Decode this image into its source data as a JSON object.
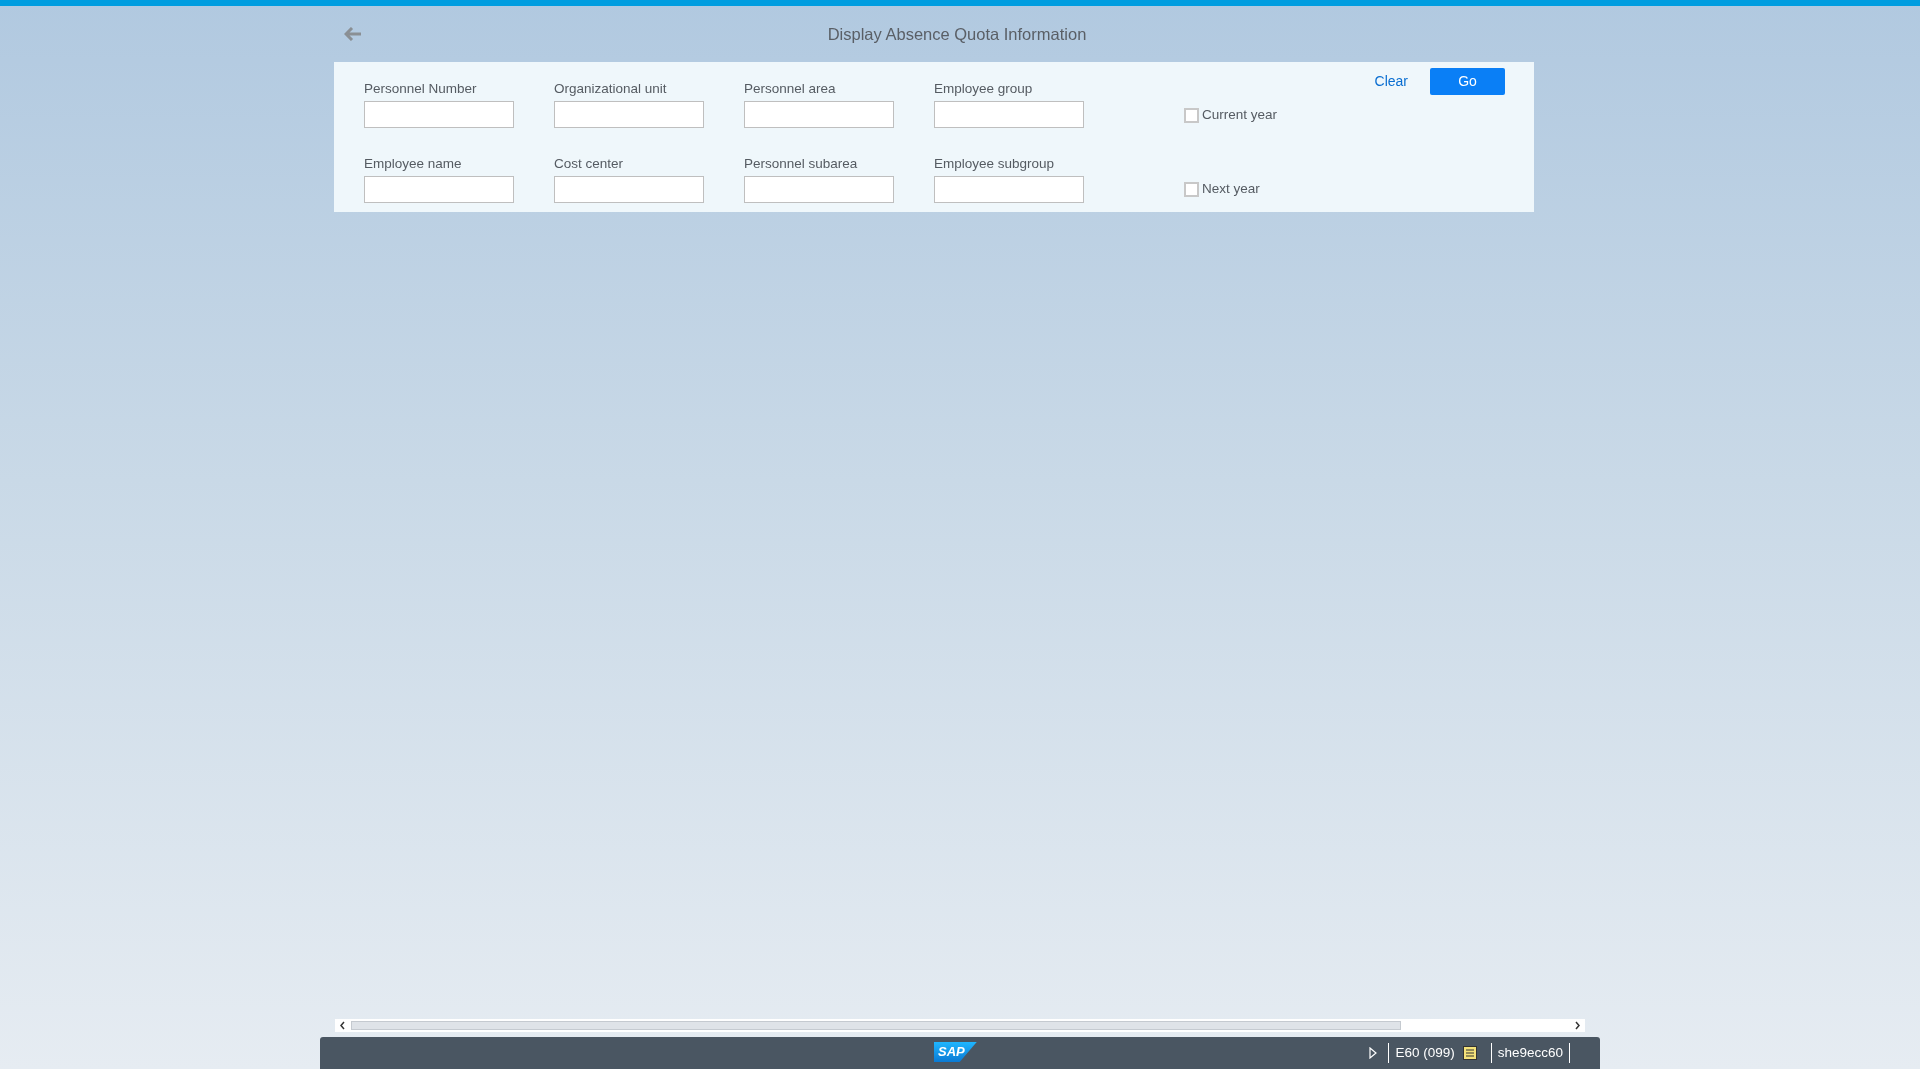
{
  "header": {
    "title": "Display Absence Quota Information"
  },
  "filters": {
    "fields": [
      {
        "label": "Personnel Number"
      },
      {
        "label": "Organizational unit"
      },
      {
        "label": "Personnel area"
      },
      {
        "label": "Employee group"
      },
      {
        "label": "Employee name"
      },
      {
        "label": "Cost center"
      },
      {
        "label": "Personnel subarea"
      },
      {
        "label": "Employee subgroup"
      }
    ],
    "checkboxes": [
      {
        "label": "Current year",
        "checked": false
      },
      {
        "label": "Next year",
        "checked": false
      }
    ],
    "buttons": [
      {
        "label": "Clear",
        "kind": "link"
      },
      {
        "label": "Go",
        "kind": "primary"
      }
    ]
  },
  "status_bar": {
    "logo": "SAP",
    "system": "E60 (099)",
    "server": "she9ecc60"
  }
}
